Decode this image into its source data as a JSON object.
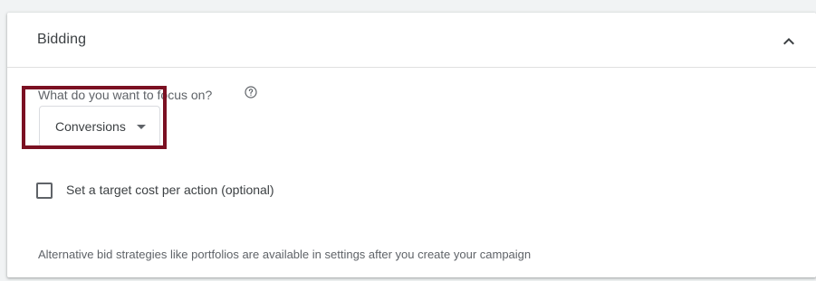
{
  "section": {
    "title": "Bidding",
    "collapse_icon": "chevron-up-icon"
  },
  "focus": {
    "question": "What do you want to focus on?",
    "help_icon": "help-circle-icon",
    "dropdown_value": "Conversions",
    "dropdown_icon": "dropdown-arrow-icon"
  },
  "target_cpa": {
    "checked": false,
    "label": "Set a target cost per action (optional)"
  },
  "footnote": "Alternative bid strategies like portfolios are available in settings after you create your campaign",
  "colors": {
    "highlight": "#7b1022",
    "text": "#3c4043",
    "secondary_text": "#5f6368",
    "border": "#dadce0"
  }
}
